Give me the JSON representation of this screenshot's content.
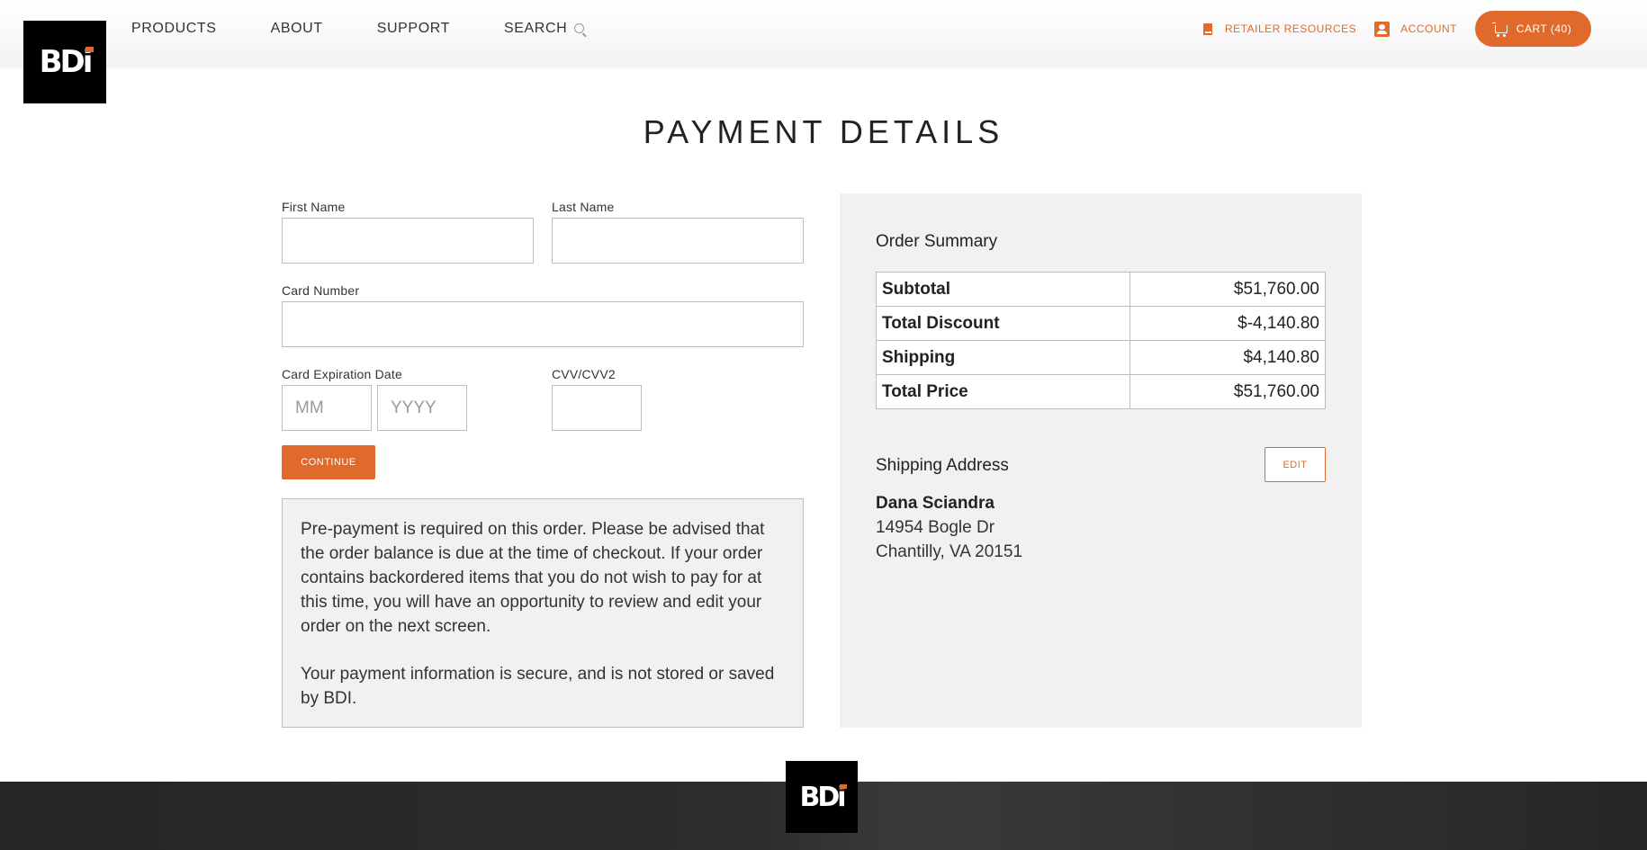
{
  "brand": {
    "logo_text": "BD",
    "logo_text_i": "i",
    "accent_color": "#e06a2c"
  },
  "nav": {
    "products": "PRODUCTS",
    "about": "ABOUT",
    "support": "SUPPORT",
    "search": "SEARCH",
    "retailer_resources": "RETAILER RESOURCES",
    "account": "ACCOUNT",
    "cart": "CART (40)"
  },
  "page": {
    "title": "PAYMENT DETAILS"
  },
  "form": {
    "first_name_label": "First Name",
    "first_name_value": "",
    "last_name_label": "Last Name",
    "last_name_value": "",
    "card_number_label": "Card Number",
    "card_number_value": "",
    "expiration_label": "Card Expiration Date",
    "month_placeholder": "MM",
    "year_placeholder": "YYYY",
    "cvv_label": "CVV/CVV2",
    "cvv_value": "",
    "continue_label": "CONTINUE"
  },
  "notice": {
    "paragraph1": "Pre-payment is required on this order. Please be advised that the order balance is due at the time of checkout. If your order contains backordered items that you do not wish to pay for at this time, you will have an opportunity to review and edit your order on the next screen.",
    "paragraph2": "Your payment information is secure, and is not stored or saved by BDI."
  },
  "summary": {
    "title": "Order Summary",
    "rows": [
      {
        "label": "Subtotal",
        "value": "$51,760.00"
      },
      {
        "label": "Total Discount",
        "value": "$-4,140.80"
      },
      {
        "label": "Shipping",
        "value": "$4,140.80"
      },
      {
        "label": "Total Price",
        "value": "$51,760.00"
      }
    ],
    "shipping_title": "Shipping Address",
    "edit_label": "EDIT",
    "address": {
      "name": "Dana Sciandra",
      "line1": "14954 Bogle Dr",
      "line2": "Chantilly, VA 20151"
    }
  },
  "icons": {
    "search": "search-icon",
    "retailer": "book-icon",
    "account": "account-icon",
    "cart": "cart-icon"
  }
}
